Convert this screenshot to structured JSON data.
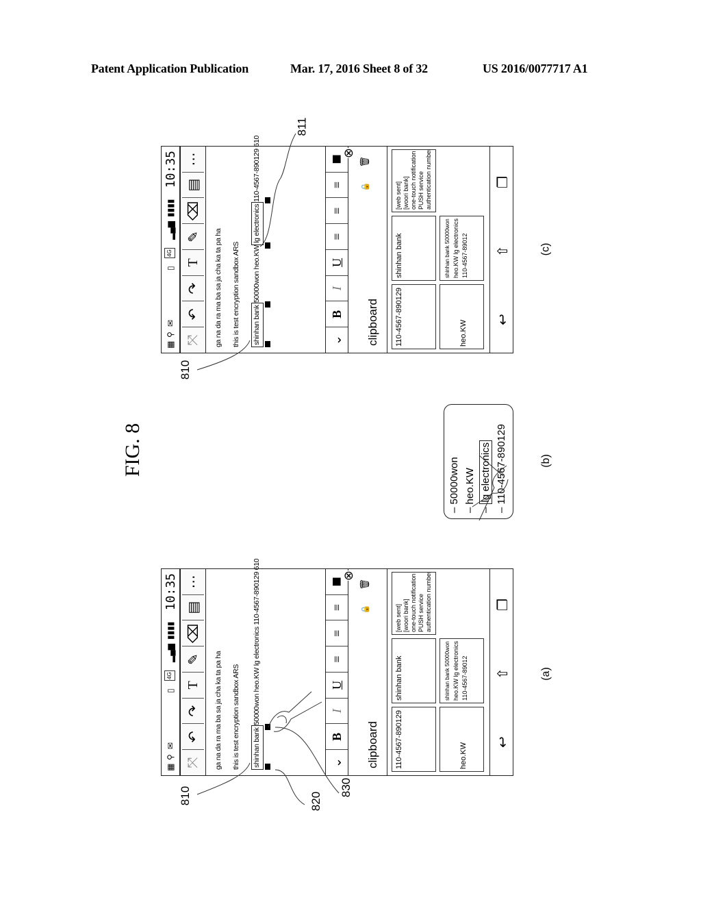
{
  "header": {
    "left": "Patent Application Publication",
    "middle": "Mar. 17, 2016  Sheet 8 of 32",
    "right": "US 2016/0077717 A1"
  },
  "figure": {
    "title": "FIG. 8",
    "panel_labels": [
      "(a)",
      "(b)",
      "(c)"
    ],
    "reference_numerals": {
      "a": [
        "810",
        "820",
        "830"
      ],
      "c": [
        "810",
        "811"
      ]
    }
  },
  "phone": {
    "status": {
      "time": "10:35",
      "icons": [
        "usb-debug-icon",
        "usb-icon",
        "mail-icon",
        "vibrate-icon",
        "4g-data-icon",
        "signal-icon",
        "battery-icon"
      ],
      "network": "4G"
    },
    "toolbar": [
      {
        "name": "expand-icon",
        "glyph": "⤧"
      },
      {
        "name": "undo-icon",
        "glyph": "↶"
      },
      {
        "name": "redo-icon",
        "glyph": "↷"
      },
      {
        "name": "text-tool-icon",
        "glyph": "T"
      },
      {
        "name": "highlighter-icon",
        "glyph": "✎"
      },
      {
        "name": "eraser-icon",
        "glyph": "⌫"
      },
      {
        "name": "layout-icon",
        "glyph": "▤"
      },
      {
        "name": "more-icon",
        "glyph": "⋯"
      }
    ],
    "editor_lines": [
      "ga na da ra ma ba sa ja cha ka ta pa ha",
      "this is test encryption sandbox ARS",
      "shinhan bank 50000won heo.KW  lg electronics 110-4567-890129 610"
    ],
    "editor_line3_parts": {
      "selected_a": "shinhan bank",
      "rest_a": "50000won heo.KW  lg electronics 110-4567-890129 610",
      "pre_c": "50000won heo.KW",
      "selected_c": "lg electronics",
      "post_c": "110-4567-890129 610"
    },
    "format_bar": [
      {
        "name": "dropdown-icon",
        "glyph": "⌄"
      },
      {
        "name": "bold-button",
        "glyph": "B"
      },
      {
        "name": "italic-button",
        "glyph": "I"
      },
      {
        "name": "underline-button",
        "glyph": "U"
      },
      {
        "name": "align-left-icon",
        "glyph": "≡"
      },
      {
        "name": "align-center-icon",
        "glyph": "≡"
      },
      {
        "name": "align-right-icon",
        "glyph": "≡"
      },
      {
        "name": "color-swatch",
        "glyph": "■"
      }
    ],
    "clipboard": {
      "title": "clipboard",
      "close_glyph": "⊗",
      "cards": [
        {
          "lines": [
            "110-4567-890129"
          ]
        },
        {
          "lines": [
            "shinhan bank"
          ]
        },
        {
          "lines": [
            "[web sent]",
            "[woori bank]",
            "one-touch notification",
            "PUSH service",
            "authentication number"
          ]
        },
        {
          "lines": [
            "heo.KW"
          ]
        },
        {
          "lines": [
            "shinhan bank 50000won",
            "heo.KW lg electronics",
            "110-4567-89012"
          ]
        }
      ]
    },
    "nav": {
      "back": "↩",
      "home": "⇧",
      "recent": "❐"
    }
  },
  "panel_b": {
    "items": [
      "50000won",
      "heo.KW",
      "lg electronics",
      "110-4567-890129"
    ],
    "selected_index": 2,
    "bullet": "–"
  }
}
